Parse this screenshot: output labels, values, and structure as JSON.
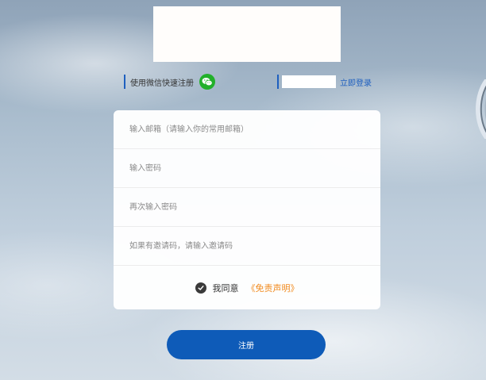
{
  "header": {
    "quick_register_label": "使用微信快速注册",
    "login_link": "立即登录"
  },
  "form": {
    "email_placeholder": "输入邮箱（请输入你的常用邮箱）",
    "password_placeholder": "输入密码",
    "confirm_password_placeholder": "再次输入密码",
    "invite_placeholder": "如果有邀请码，请输入邀请码",
    "agree_label": "我同意",
    "disclaimer_link": "《免责声明》",
    "agree_checked": true
  },
  "actions": {
    "register_label": "注册"
  },
  "icons": {
    "wechat": "wechat-icon",
    "check": "check-icon"
  },
  "colors": {
    "accent": "#0e5bb8",
    "wechat_green": "#22b02a",
    "disclaimer_orange": "#f18a1e"
  }
}
